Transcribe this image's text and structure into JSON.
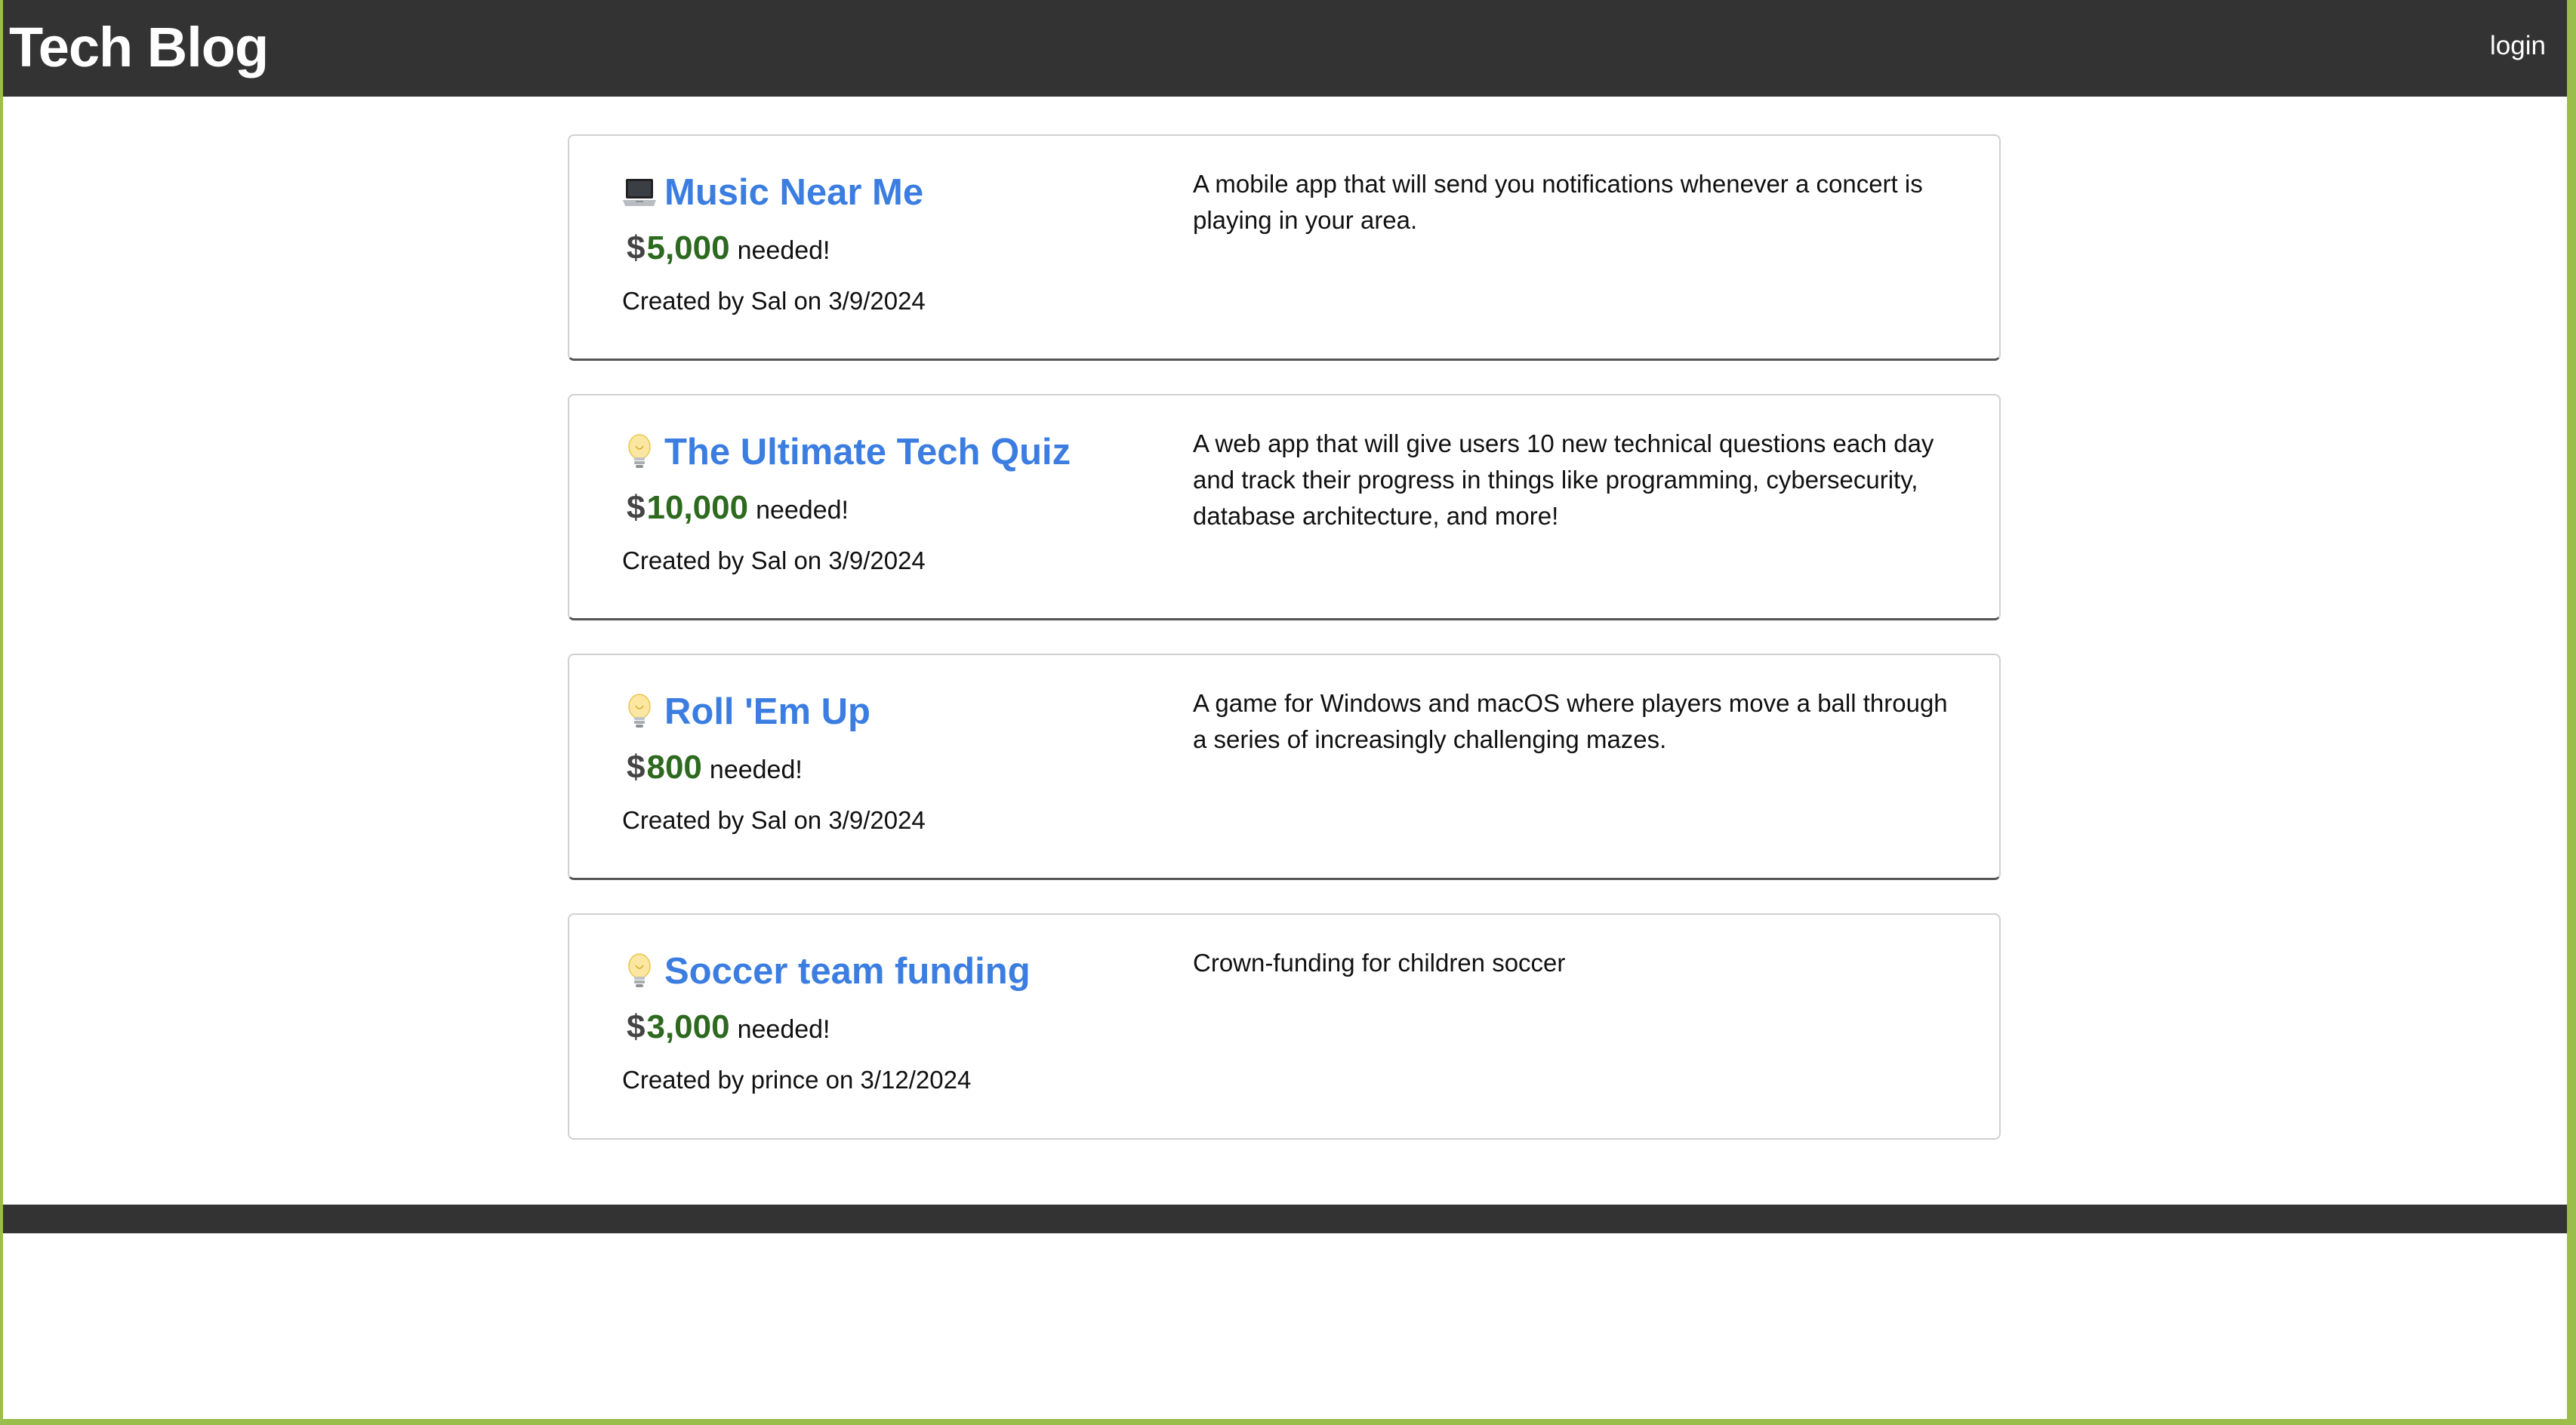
{
  "header": {
    "title": "Tech Blog",
    "login_label": "login"
  },
  "posts": [
    {
      "icon": "laptop-icon",
      "title": "Music Near Me",
      "currency": "$",
      "amount": "5,000",
      "needed_label": "needed!",
      "created": "Created by Sal on 3/9/2024",
      "description": "A mobile app that will send you notifications whenever a concert is playing in your area."
    },
    {
      "icon": "lightbulb-icon",
      "title": "The Ultimate Tech Quiz",
      "currency": "$",
      "amount": "10,000",
      "needed_label": "needed!",
      "created": "Created by Sal on 3/9/2024",
      "description": "A web app that will give users 10 new technical questions each day and track their progress in things like programming, cybersecurity, database architecture, and more!"
    },
    {
      "icon": "lightbulb-icon",
      "title": "Roll 'Em Up",
      "currency": "$",
      "amount": "800",
      "needed_label": "needed!",
      "created": "Created by Sal on 3/9/2024",
      "description": "A game for Windows and macOS where players move a ball through a series of increasingly challenging mazes."
    },
    {
      "icon": "lightbulb-icon",
      "title": "Soccer team funding",
      "currency": "$",
      "amount": "3,000",
      "needed_label": "needed!",
      "created": "Created by prince on 3/12/2024",
      "description": "Crown-funding for children soccer"
    }
  ],
  "colors": {
    "header_bg": "#333333",
    "title_link": "#3b7de0",
    "amount": "#2d6a1f",
    "frame": "#9bbd4c"
  }
}
